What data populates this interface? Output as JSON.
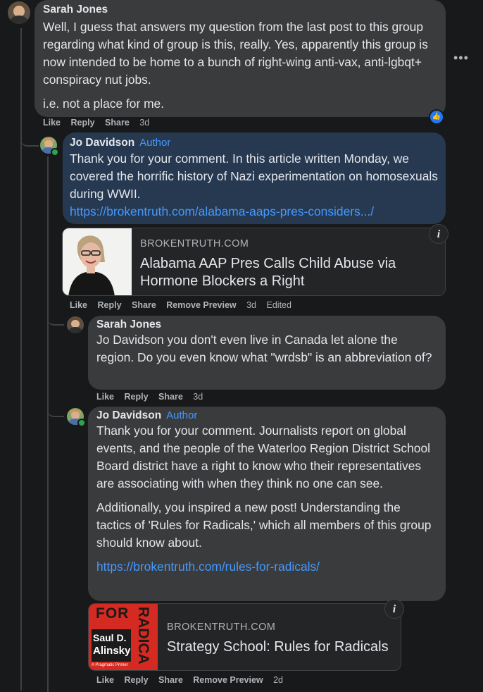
{
  "comments": [
    {
      "author": "Sarah Jones",
      "paragraphs": [
        "Well, I guess that answers my question from the last post to this group regarding what kind of group is this, really. Yes, apparently this group is now intended to be home to a bunch of right-wing anti-vax, anti-lgbqt+ conspiracy nut jobs.",
        "i.e. not a place for me."
      ],
      "actions": [
        "Like",
        "Reply",
        "Share"
      ],
      "time": "3d",
      "reaction_icon": "thumbs-up-icon",
      "more_icon": "more-options-icon"
    },
    {
      "author": "Jo Davidson",
      "badge": "Author",
      "text": "Thank you for your comment. In this article written Monday, we covered the horrific history of Nazi experimentation on homosexuals during WWII.",
      "link": "https://brokentruth.com/alabama-aaps-pres-considers.../",
      "preview": {
        "site": "BROKENTRUTH.COM",
        "title": "Alabama AAP Pres Calls Child Abuse via Hormone Blockers a Right"
      },
      "actions": [
        "Like",
        "Reply",
        "Share",
        "Remove Preview"
      ],
      "time": "3d",
      "edited": "Edited"
    },
    {
      "author": "Sarah Jones",
      "text": "Jo Davidson you don't even live in Canada let alone the region. Do you even know what \"wrdsb\" is an abbreviation of?",
      "actions": [
        "Like",
        "Reply",
        "Share"
      ],
      "time": "3d"
    },
    {
      "author": "Jo Davidson",
      "badge": "Author",
      "paragraphs": [
        "Thank you for your comment. Journalists report on global events, and the people of the Waterloo Region District School Board district have a right to know who their representatives are associating with when they think no one can see.",
        "Additionally, you inspired a new post! Understanding the tactics of 'Rules for Radicals,' which all members of this group should know about."
      ],
      "link": "https://brokentruth.com/rules-for-radicals/",
      "preview": {
        "site": "BROKENTRUTH.COM",
        "title": "Strategy School: Rules for Radicals",
        "book_top": "FOR",
        "book_side": "RADICA",
        "book_author_first": "Saul D.",
        "book_author_last": "Alinsky",
        "book_subtitle": "A Pragmatic Primer"
      },
      "actions": [
        "Like",
        "Reply",
        "Share",
        "Remove Preview"
      ],
      "time": "2d"
    }
  ],
  "info_glyph": "i",
  "colors": {
    "background": "#18191a",
    "bubble": "#3a3b3c",
    "highlight_bubble": "#263951",
    "link": "#4599ff",
    "like_blue": "#2078f4"
  }
}
